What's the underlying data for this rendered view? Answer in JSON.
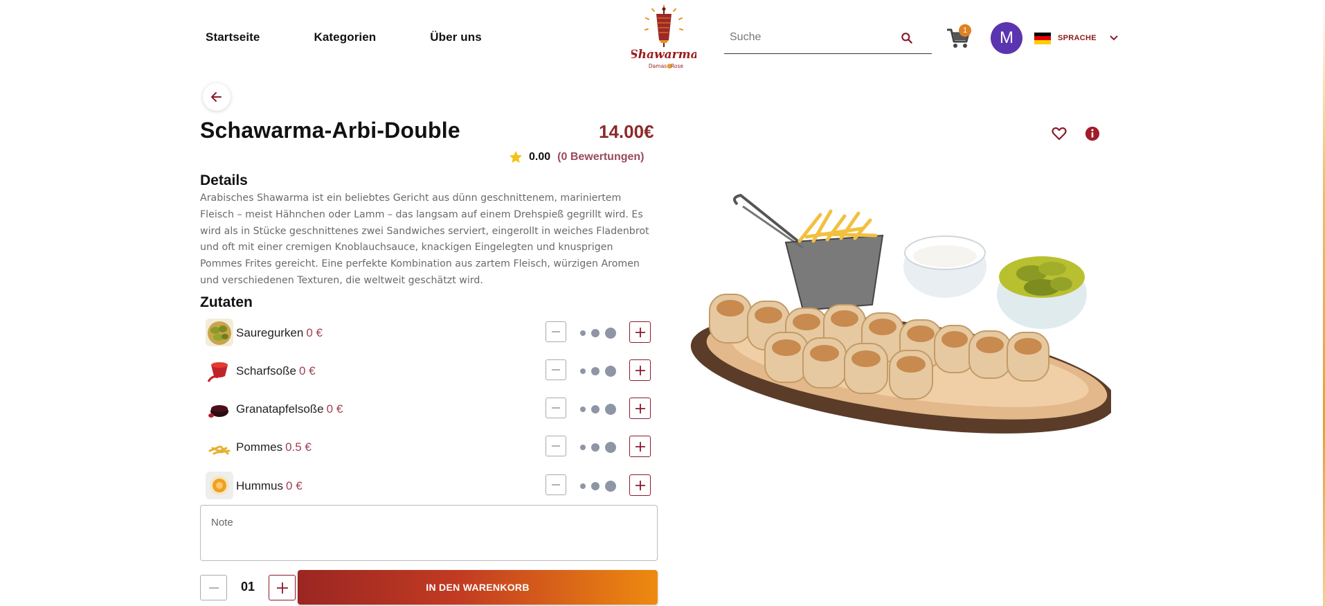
{
  "nav": {
    "home": "Startseite",
    "categories": "Kategorien",
    "about": "Über uns"
  },
  "logo": {
    "brand": "Shawarma",
    "sub": "Damas Rose"
  },
  "search": {
    "placeholder": "Suche",
    "icon": "search-icon"
  },
  "cart": {
    "icon": "cart-icon",
    "count": "1"
  },
  "user": {
    "initial": "M",
    "color": "#5b34b0"
  },
  "language": {
    "label": "SPRACHE",
    "flag": "flag-de-icon"
  },
  "product": {
    "title": "Schawarma-Arbi-Double",
    "price": "14.00€",
    "rating": "0.00",
    "rating_count": "(0 Bewertungen)",
    "details_heading": "Details",
    "details_text": "Arabisches Shawarma ist ein beliebtes Gericht aus dünn geschnittenem, mariniertem Fleisch – meist Hähnchen oder Lamm – das langsam auf einem Drehspieß gegrillt wird. Es wird als in Stücke geschnittenes zwei Sandwiches serviert, eingerollt in weiches Fladenbrot und oft mit einer cremigen Knoblauchsauce, knackigen Eingelegten und knusprigen Pommes Frites gereicht. Eine perfekte Kombination aus zartem Fleisch, würzigen Aromen und verschiedenen Texturen, die weltweit geschätzt wird.",
    "ingredients_heading": "Zutaten"
  },
  "ingredients": [
    {
      "name": "Sauregurken",
      "price": "0 €"
    },
    {
      "name": "Scharfsoße",
      "price": "0 €"
    },
    {
      "name": "Granatapfelsoße",
      "price": "0 €"
    },
    {
      "name": "Pommes",
      "price": "0.5 €"
    },
    {
      "name": "Hummus",
      "price": "0 €"
    }
  ],
  "note": {
    "placeholder": "Note"
  },
  "order": {
    "quantity": "01",
    "add_to_cart": "IN DEN WARENKORB"
  },
  "colors": {
    "brand": "#8b1a2a",
    "price": "#8b2a2a",
    "accent_orange": "#ee8a10",
    "star": "#f2c21a"
  }
}
